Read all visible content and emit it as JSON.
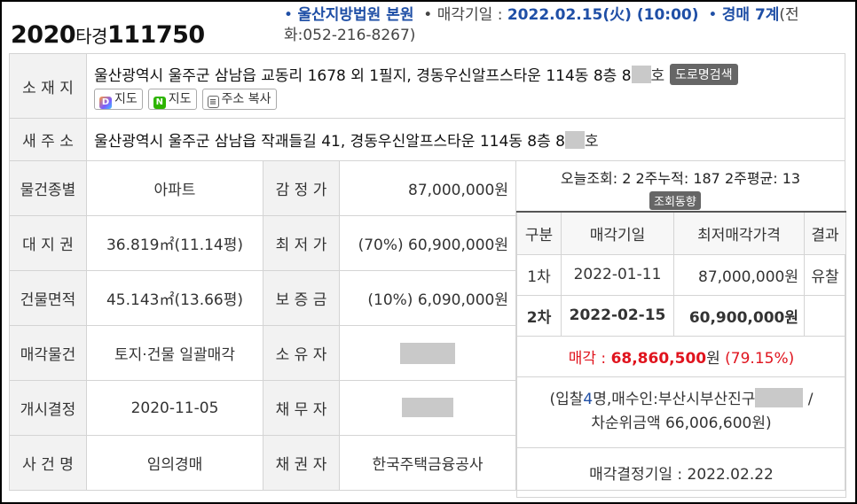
{
  "header": {
    "case_year": "2020",
    "case_type": "타경",
    "case_no": "111750",
    "court": "울산지방법원 본원",
    "sale_date_label": "매각기일 : ",
    "sale_date": "2022.02.15(火) (10:00)",
    "dept": "경매 7계",
    "phone_label": "(전",
    "phone": "화:052-216-8267)"
  },
  "address": {
    "label": "소 재 지",
    "text": "울산광역시 울주군 삼남읍 교동리 1678 외 1필지, 경동우신알프스타운 114동 8층 8",
    "suffix": "호",
    "road_search": "도로명검색",
    "btn_daum_map": "지도",
    "btn_naver_map": "지도",
    "btn_copy": "주소 복사"
  },
  "new_address": {
    "label": "새 주 소",
    "text": "울산광역시 울주군 삼남읍 작괘들길 41, 경동우신알프스타운 114동 8층 8",
    "suffix": "호"
  },
  "details": {
    "rows": [
      {
        "l1": "물건종별",
        "v1": "아파트",
        "l2": "감 정 가",
        "v2": "87,000,000원"
      },
      {
        "l1": "대 지 권",
        "v1": "36.819㎡(11.14평)",
        "l2": "최 저 가",
        "v2": "(70%) 60,900,000원"
      },
      {
        "l1": "건물면적",
        "v1": "45.143㎡(13.66평)",
        "l2": "보 증 금",
        "v2": "(10%) 6,090,000원"
      },
      {
        "l1": "매각물건",
        "v1": "토지·건물 일괄매각",
        "l2": "소 유 자",
        "v2": ""
      },
      {
        "l1": "개시결정",
        "v1": "2020-11-05",
        "l2": "채 무 자",
        "v2": ""
      },
      {
        "l1": "사 건 명",
        "v1": "임의경매",
        "l2": "채 권 자",
        "v2": "한국주택금융공사"
      }
    ]
  },
  "views": {
    "text": "오늘조회: 2  2주누적: 187  2주평균: 13",
    "trend_button": "조회동향"
  },
  "history": {
    "headers": [
      "구분",
      "매각기일",
      "최저매각가격",
      "결과"
    ],
    "rows": [
      {
        "round": "1차",
        "date": "2022-01-11",
        "price": "87,000,000원",
        "result": "유찰"
      },
      {
        "round": "2차",
        "date": "2022-02-15",
        "price": "60,900,000원",
        "result": ""
      }
    ],
    "sale_label": "매각 : ",
    "sale_amount": "68,860,500",
    "sale_unit": "원",
    "sale_ratio": "(79.15%)",
    "bid_prefix": "(입찰",
    "bid_count": "4",
    "bid_suffix": "명,매수인:부산시부산진구",
    "bid_end": " /",
    "second_bid": "차순위금액 66,006,600원)",
    "decision": "매각결정기일 : 2022.02.22"
  }
}
